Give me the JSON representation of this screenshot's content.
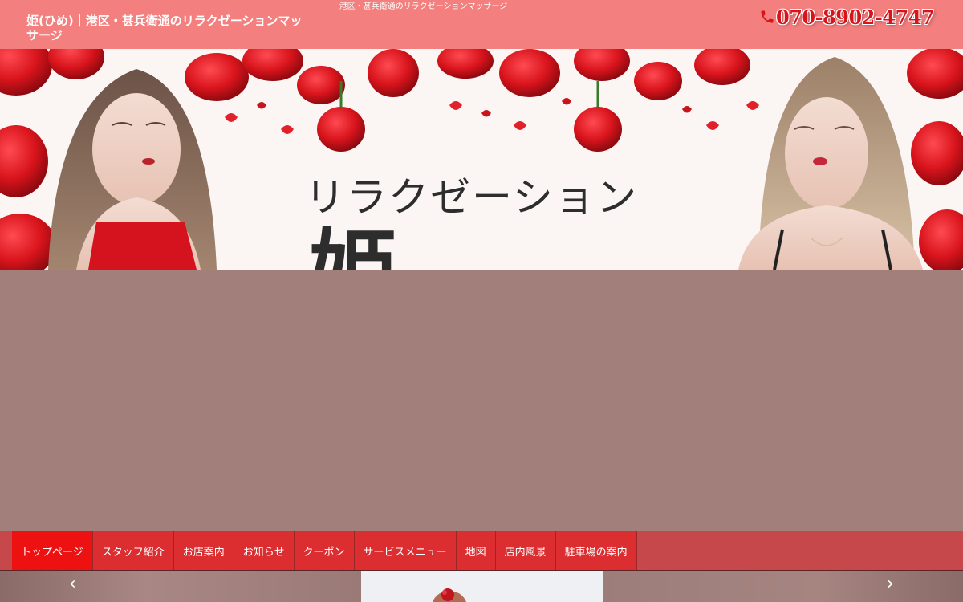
{
  "header": {
    "tagline": "港区・甚兵衛通のリラクゼーションマッサージ",
    "site_title": "姫(ひめ)｜港区・甚兵衛通のリラクゼーションマッサージ",
    "phone": "070-8902-4747",
    "colors": {
      "background": "#f37f7f",
      "phone": "#d8141b"
    }
  },
  "hero": {
    "heading": "リラクゼーション",
    "big_text": "姫"
  },
  "nav": {
    "items": [
      {
        "label": "トップページ",
        "active": true
      },
      {
        "label": "スタッフ紹介"
      },
      {
        "label": "お店案内"
      },
      {
        "label": "お知らせ"
      },
      {
        "label": "クーポン"
      },
      {
        "label": "サービスメニュー"
      },
      {
        "label": "地図"
      },
      {
        "label": "店内風景"
      },
      {
        "label": "駐車場の案内"
      }
    ],
    "colors": {
      "bar": "#c6484a",
      "item": "#dc2e30",
      "active": "#ee1111"
    }
  },
  "slider": {
    "prev": "‹",
    "next": "›"
  }
}
